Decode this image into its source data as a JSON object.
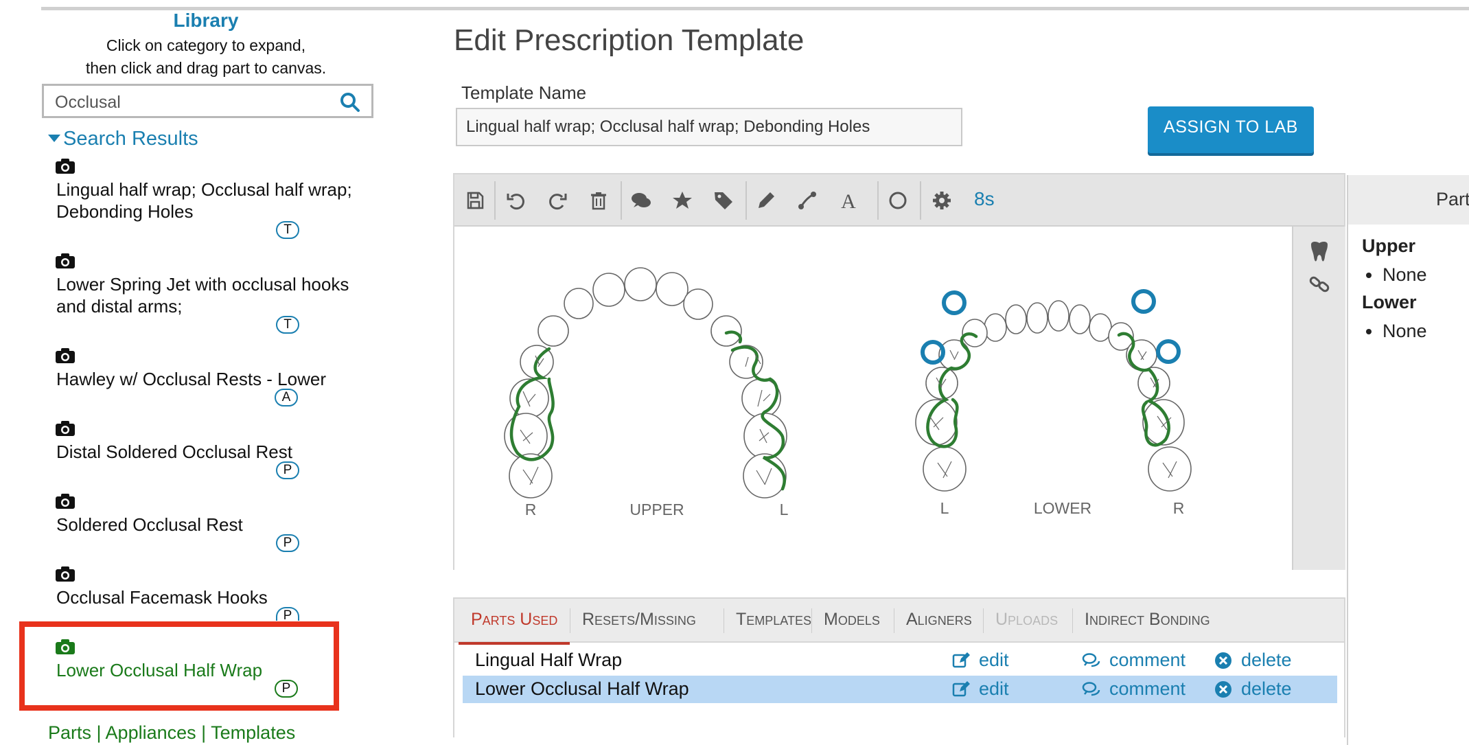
{
  "sidebar": {
    "title": "Library",
    "help_line1": "Click on category to expand,",
    "help_line2": "then click and drag part to canvas.",
    "search_value": "Occlusal",
    "results_heading": "Search Results",
    "results": [
      {
        "name": "Lingual half wrap; Occlusal half wrap; Debonding Holes",
        "badge": "T"
      },
      {
        "name": "Lower Spring Jet with occlusal hooks and distal arms;",
        "badge": "T"
      },
      {
        "name": "Hawley w/ Occlusal Rests - Lower",
        "badge": "A"
      },
      {
        "name": "Distal Soldered Occlusal Rest",
        "badge": "P"
      },
      {
        "name": "Soldered Occlusal Rest",
        "badge": "P"
      },
      {
        "name": "Occlusal Facemask Hooks",
        "badge": "P"
      },
      {
        "name": "Lower Occlusal Half Wrap",
        "badge": "P",
        "selected": true
      }
    ],
    "bottom_links": "Parts | Appliances | Templates"
  },
  "main": {
    "title": "Edit Prescription Template",
    "template_name_label": "Template Name",
    "template_name_value": "Lingual half wrap; Occlusal half wrap; Debonding Holes",
    "assign_button": "ASSIGN TO LAB",
    "toolbar": {
      "icons": [
        "save-icon",
        "undo-icon",
        "redo-icon",
        "trash-icon",
        "comment-icon",
        "star-icon",
        "tag-icon",
        "pencil-icon",
        "wire-icon",
        "text-icon",
        "circle-icon",
        "gear-icon"
      ],
      "timer": "8s"
    },
    "arch_labels": {
      "upper_r": "R",
      "upper": "UPPER",
      "upper_l": "L",
      "lower_l": "L",
      "lower": "LOWER",
      "lower_r": "R"
    },
    "side_icons": [
      "tooth-icon",
      "link-icon"
    ]
  },
  "right_panel": {
    "header": "Part",
    "upper_label": "Upper",
    "upper_item": "None",
    "lower_label": "Lower",
    "lower_item": "None"
  },
  "tabs": [
    {
      "label": "Parts Used",
      "state": "active"
    },
    {
      "label": "Resets/Missing",
      "state": "normal"
    },
    {
      "label": "Templates",
      "state": "normal"
    },
    {
      "label": "Models",
      "state": "normal"
    },
    {
      "label": "Aligners",
      "state": "normal"
    },
    {
      "label": "Uploads",
      "state": "disabled"
    },
    {
      "label": "Indirect Bonding",
      "state": "normal"
    }
  ],
  "parts_used": [
    {
      "name": "Lingual Half Wrap",
      "edit": "edit",
      "comment": "comment",
      "delete": "delete",
      "selected": false
    },
    {
      "name": "Lower Occlusal Half Wrap",
      "edit": "edit",
      "comment": "comment",
      "delete": "delete",
      "selected": true
    }
  ],
  "colors": {
    "accent": "#1a8dc8",
    "link": "#1a7fb0",
    "selected_green": "#1a7a1a",
    "wire_green": "#2e7d32",
    "active_tab": "#c0392b",
    "highlight_box": "#e8321c",
    "selected_row": "#b8d7f4"
  }
}
